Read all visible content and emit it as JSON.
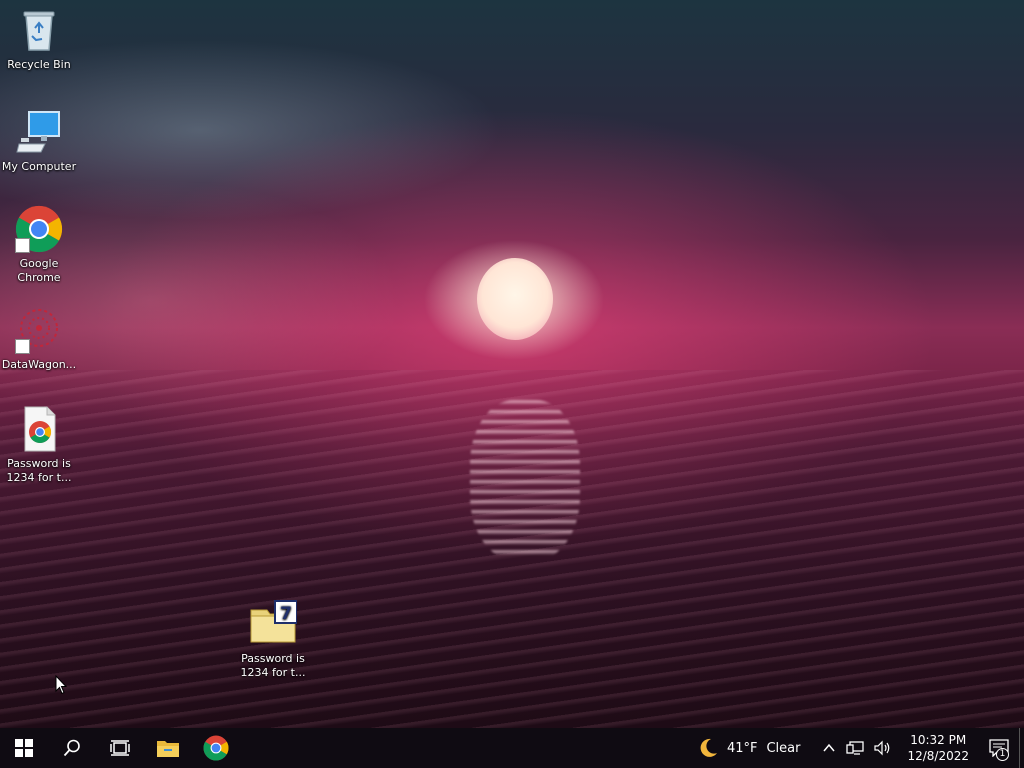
{
  "desktop": {
    "icons": [
      {
        "label": "Recycle Bin",
        "icon": "recycle-bin-icon"
      },
      {
        "label": "My Computer",
        "icon": "computer-icon"
      },
      {
        "label": "Google Chrome",
        "icon": "chrome-icon"
      },
      {
        "label": "DataWagon...",
        "icon": "datawagon-icon"
      },
      {
        "label": "Password is 1234 for t...",
        "icon": "chrome-document-icon"
      },
      {
        "label": "Password is 1234 for t...",
        "icon": "7zip-archive-icon"
      }
    ]
  },
  "taskbar": {
    "pinned": [
      "start-icon",
      "search-icon",
      "task-view-icon",
      "file-explorer-icon",
      "chrome-icon"
    ],
    "weather": {
      "temp": "41°F",
      "condition": "Clear"
    },
    "clock": {
      "time": "10:32 PM",
      "date": "12/8/2022"
    },
    "notification_count": "1"
  },
  "colors": {
    "taskbar": "#0f0b12",
    "chrome_red": "#db4437",
    "chrome_green": "#0f9d58",
    "chrome_yellow": "#f4b400",
    "chrome_blue": "#4285f4",
    "start_blue": "#ffffff"
  }
}
